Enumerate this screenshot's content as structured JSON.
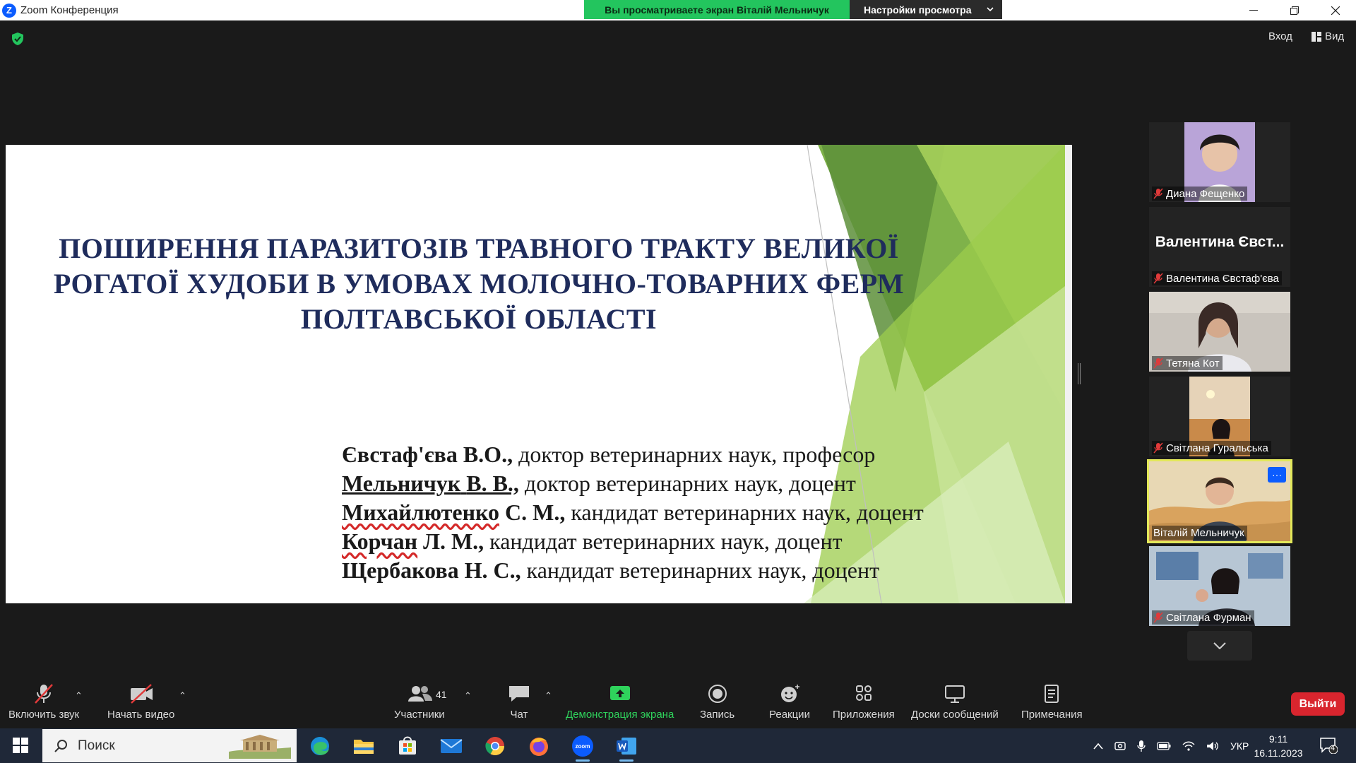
{
  "window": {
    "title": "Zoom Конференция",
    "viewing_banner": "Вы просматриваете экран Віталій Мельничук",
    "view_settings": "Настройки просмотра",
    "enter_label": "Вход",
    "view_label": "Вид"
  },
  "slide": {
    "title_lines": [
      "ПОШИРЕННЯ ПАРАЗИТОЗІВ ТРАВНОГО ТРАКТУ ВЕЛИКОЇ",
      "РОГАТОЇ ХУДОБИ В УМОВАХ МОЛОЧНО-ТОВАРНИХ ФЕРМ",
      "ПОЛТАВСЬКОЇ ОБЛАСТІ"
    ],
    "authors": [
      {
        "surname": "Євстаф'єва",
        "initials": "В.О.,",
        "role": " доктор ветеринарних наук, професор"
      },
      {
        "surname": "Мельничук",
        "initials": "В. В.,",
        "role": " доктор ветеринарних наук, доцент"
      },
      {
        "surname": "Михайлютенко",
        "initials": "С. М.,",
        "role": " кандидат ветеринарних наук, доцент"
      },
      {
        "surname": "Корчан",
        "initials": "Л. М.,",
        "role": " кандидат ветеринарних наук, доцент"
      },
      {
        "surname": "Щербакова",
        "initials": "Н. С.,",
        "role": " кандидат ветеринарних наук, доцент"
      }
    ]
  },
  "participants": [
    {
      "name": "Диана Фещенко",
      "muted": true,
      "video": "photo"
    },
    {
      "name": "Валентина Євстаф'єва",
      "display": "Валентина Євст...",
      "muted": true,
      "video": "off"
    },
    {
      "name": "Тетяна Кот",
      "muted": true,
      "video": "photo"
    },
    {
      "name": "Світлана Гуральська",
      "muted": true,
      "video": "photo"
    },
    {
      "name": "Віталій Мельничук",
      "muted": false,
      "video": "photo",
      "active_speaker": true,
      "menu": "···"
    },
    {
      "name": "Світлана Фурман",
      "muted": true,
      "video": "photo"
    }
  ],
  "toolbar": {
    "unmute": "Включить звук",
    "start_video": "Начать видео",
    "participants": "Участники",
    "participants_count": "41",
    "chat": "Чат",
    "share": "Демонстрация экрана",
    "record": "Запись",
    "reactions": "Реакции",
    "apps": "Приложения",
    "whiteboards": "Доски сообщений",
    "notes": "Примечания",
    "leave": "Выйти"
  },
  "taskbar": {
    "search_placeholder": "Поиск",
    "language": "УКР",
    "time": "9:11",
    "date": "16.11.2023",
    "notifications": "4",
    "zoom_app_label": "zoom"
  },
  "colors": {
    "share_green": "#2fd35c",
    "leave_red": "#d9252e",
    "active_outline": "#e3e85a",
    "title_navy": "#1f2c5c"
  }
}
